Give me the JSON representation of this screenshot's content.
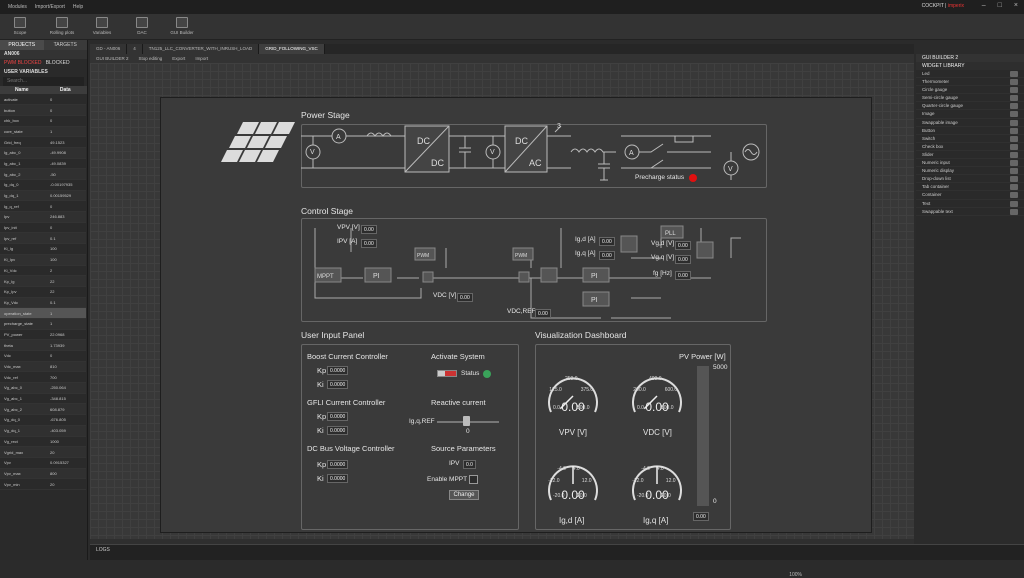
{
  "menubar": {
    "items": [
      "Modules",
      "Import/Export",
      "Help"
    ],
    "brand1": "COCKPIT",
    "brand2": "imperix"
  },
  "toolbar": {
    "buttons": [
      "Scope",
      "Rolling plots",
      "Variables",
      "DAC",
      "GUI Builder"
    ]
  },
  "left": {
    "tabs": [
      "PROJECTS",
      "TARGETS"
    ],
    "device": "AN006",
    "pwm_blocked": "PWM BLOCKED",
    "blocked": "BLOCKED",
    "section": "USER VARIABLES",
    "search_placeholder": "Search...",
    "col_name": "Name",
    "col_data": "Data",
    "rows": [
      [
        "activate",
        "0"
      ],
      [
        "button",
        "0"
      ],
      [
        "chk_box",
        "0"
      ],
      [
        "core_state",
        "1"
      ],
      [
        "Grid_freq",
        "49.1523"
      ],
      [
        "Ig_abc_0",
        "-49.9908"
      ],
      [
        "Ig_abc_1",
        "-49.0839"
      ],
      [
        "Ig_abc_2",
        "-50"
      ],
      [
        "Ig_dq_0",
        "-0.00197935"
      ],
      [
        "Ig_dq_1",
        "0.00159529"
      ],
      [
        "Ig_q_ref",
        "0"
      ],
      [
        "Ipv",
        "246.883"
      ],
      [
        "Ipv_init",
        "0"
      ],
      [
        "Ipv_ref",
        "0.1"
      ],
      [
        "Ki_Ig",
        "100"
      ],
      [
        "Ki_Ipv",
        "100"
      ],
      [
        "Ki_Vdc",
        "2"
      ],
      [
        "Kp_Ig",
        "22"
      ],
      [
        "Kp_Ipv",
        "22"
      ],
      [
        "Kp_Vdc",
        "0.1"
      ],
      [
        "operation_state",
        "1"
      ],
      [
        "precharge_state",
        "1"
      ],
      [
        "PV_power",
        "22.0968"
      ],
      [
        "theta",
        "1.73939"
      ],
      [
        "Vdc",
        "0"
      ],
      [
        "Vdc_max",
        "810"
      ],
      [
        "Vdc_ref",
        "700"
      ],
      [
        "Vg_abc_0",
        "-250.064"
      ],
      [
        "Vg_abc_1",
        "-348.815"
      ],
      [
        "Vg_abc_2",
        "608.879"
      ],
      [
        "Vg_dq_0",
        "-676.805"
      ],
      [
        "Vg_dq_1",
        "-403.059"
      ],
      [
        "Vg_rect",
        "1000"
      ],
      [
        "Vgrid_max",
        "20"
      ],
      [
        "Vpv",
        "0.0915327"
      ],
      [
        "Vpv_max",
        "800"
      ],
      [
        "Vpv_min",
        "20"
      ]
    ]
  },
  "center": {
    "tabs": [
      "GD - AN006",
      "4",
      "TN125_LLC_CONVERTER_WITH_INRUSH_LOAD",
      "GRID_FOLLOWING_VSC"
    ],
    "gb_title": "GUI BUILDER 2",
    "stop": "Stop editing",
    "export": "Export",
    "import": "Import",
    "zoom": "100%"
  },
  "panel": {
    "power_stage": "Power Stage",
    "control_stage": "Control Stage",
    "user_input": "User Input Panel",
    "viz": "Visualization Dashboard",
    "precharge": "Precharge status",
    "blocks": {
      "dcdc_top": "DC",
      "dcdc_bot": "DC",
      "dcac_top": "DC",
      "dcac_bot": "AC",
      "three": "3",
      "mppt": "MPPT",
      "pi1": "PI",
      "pi2": "PI",
      "pi3": "PI",
      "pwm1": "PWM",
      "pwm2": "PWM",
      "pll": "PLL"
    },
    "ctrl": {
      "vpv": "VPV [V]",
      "ipv": "IPV [A]",
      "vdc": "VDC [V]",
      "vdcref": "VDC,REF",
      "igd": "Ig,d [A]",
      "igq": "Ig,q [A]",
      "vgd": "Vg,d [V]",
      "vgq": "Vg,q [V]",
      "fg": "fg [Hz]",
      "zero": "0.00"
    },
    "boost": {
      "title": "Boost Current Controller",
      "kp": "Kp",
      "ki": "Ki",
      "kp_val": "0.0000",
      "ki_val": "0.0000"
    },
    "gfli": {
      "title": "GFLI Current Controller",
      "kp": "Kp",
      "ki": "Ki",
      "kp_val": "0.0000",
      "ki_val": "0.0000"
    },
    "dcbus": {
      "title": "DC Bus Voltage Controller",
      "kp": "Kp",
      "ki": "Ki",
      "kp_val": "0.0000",
      "ki_val": "0.0000"
    },
    "activate": {
      "title": "Activate System",
      "status": "Status"
    },
    "reactive": {
      "title": "Reactive current",
      "label": "Ig,q,REF",
      "value": "0"
    },
    "source": {
      "title": "Source Parameters",
      "ipv": "IPV",
      "ipv_val": "0.0",
      "mppt": "Enable MPPT",
      "change": "Change"
    },
    "gauges": [
      {
        "label": "VPV [V]",
        "value": "0.00",
        "ticks": [
          "250.0",
          "125.0",
          "375.0",
          "0.0",
          "500.0"
        ],
        "level": 0
      },
      {
        "label": "VDC [V]",
        "value": "0.00",
        "ticks": [
          "400.0",
          "200.0",
          "600.0",
          "0.0",
          "800.0"
        ],
        "level": 0
      },
      {
        "label": "Ig,d [A]",
        "value": "0.00",
        "ticks": [
          "-4.0",
          "4.0",
          "-12.0",
          "12.0",
          "-20.0",
          "20.0"
        ],
        "level": 0.5
      },
      {
        "label": "Ig,q [A]",
        "value": "0.00",
        "ticks": [
          "-4.0",
          "4.0",
          "-12.0",
          "12.0",
          "-20.0",
          "20.0"
        ],
        "level": 0.5
      }
    ],
    "pvpower": {
      "title": "PV Power [W]",
      "max": "5000",
      "min": "0",
      "value": "0.00",
      "level": 0
    }
  },
  "right": {
    "header": "GUI BUILDER 2",
    "library": "WIDGET LIBRARY",
    "items": [
      "Led",
      "Thermometer",
      "Circle gauge",
      "Semi-circle gauge",
      "Quarter-circle gauge",
      "Image",
      "Swappable image",
      "Button",
      "Switch",
      "Check box",
      "Slider",
      "Numeric input",
      "Numeric display",
      "Drop-down list",
      "Tab container",
      "Container",
      "Text",
      "Swappable text"
    ]
  },
  "log": {
    "label": "LOGS"
  }
}
